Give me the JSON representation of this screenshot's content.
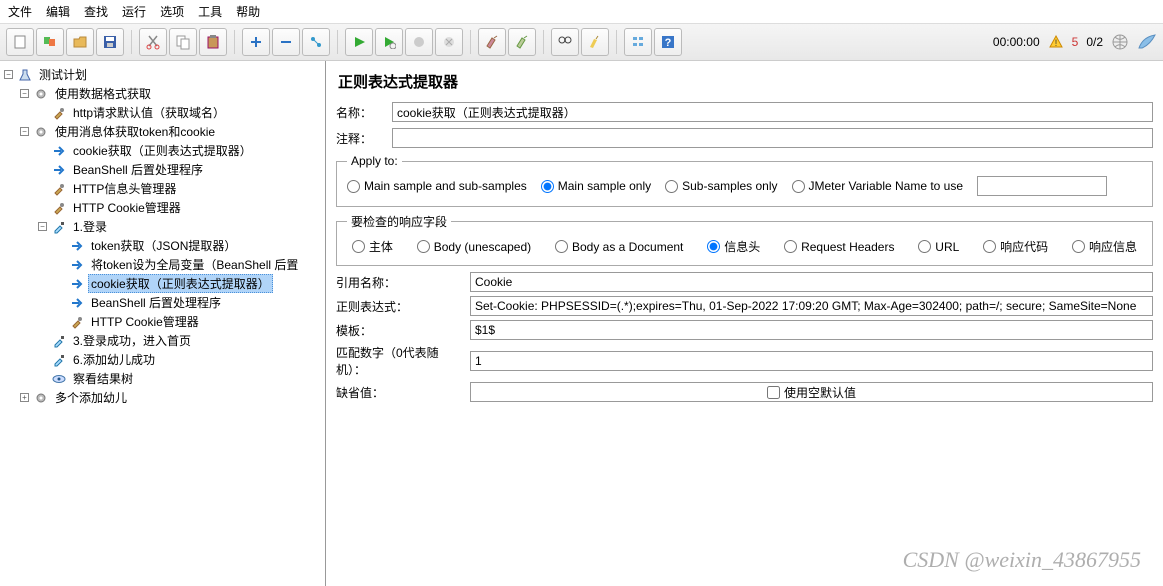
{
  "menu": [
    "文件",
    "编辑",
    "查找",
    "运行",
    "选项",
    "工具",
    "帮助"
  ],
  "status": {
    "time": "00:00:00",
    "warn": 5,
    "threads": "0/2"
  },
  "tree": [
    {
      "d": 0,
      "t": "m",
      "icon": "flask",
      "label": "测试计划"
    },
    {
      "d": 1,
      "t": "m",
      "icon": "gear",
      "label": "使用数据格式获取"
    },
    {
      "d": 2,
      "t": "",
      "icon": "wrench",
      "label": "http请求默认值（获取域名）"
    },
    {
      "d": 1,
      "t": "m",
      "icon": "gear",
      "label": "使用消息体获取token和cookie"
    },
    {
      "d": 2,
      "t": "",
      "icon": "arrow",
      "label": "cookie获取（正则表达式提取器）"
    },
    {
      "d": 2,
      "t": "",
      "icon": "arrow",
      "label": "BeanShell 后置处理程序"
    },
    {
      "d": 2,
      "t": "",
      "icon": "wrench",
      "label": "HTTP信息头管理器"
    },
    {
      "d": 2,
      "t": "",
      "icon": "wrench",
      "label": "HTTP Cookie管理器"
    },
    {
      "d": 2,
      "t": "m",
      "icon": "dropper",
      "label": "1.登录"
    },
    {
      "d": 3,
      "t": "",
      "icon": "arrow",
      "label": "token获取（JSON提取器）"
    },
    {
      "d": 3,
      "t": "",
      "icon": "arrow",
      "label": "将token设为全局变量（BeanShell 后置"
    },
    {
      "d": 3,
      "t": "",
      "icon": "arrow",
      "label": "cookie获取（正则表达式提取器）",
      "sel": true
    },
    {
      "d": 3,
      "t": "",
      "icon": "arrow",
      "label": "BeanShell 后置处理程序"
    },
    {
      "d": 3,
      "t": "",
      "icon": "wrench",
      "label": "HTTP Cookie管理器"
    },
    {
      "d": 2,
      "t": "",
      "icon": "dropper",
      "label": "3.登录成功，进入首页"
    },
    {
      "d": 2,
      "t": "",
      "icon": "dropper",
      "label": "6.添加幼儿成功"
    },
    {
      "d": 2,
      "t": "",
      "icon": "eye",
      "label": "察看结果树"
    },
    {
      "d": 1,
      "t": "p",
      "icon": "gear",
      "label": "多个添加幼儿"
    }
  ],
  "form": {
    "title": "正则表达式提取器",
    "name_lbl": "名称：",
    "name_val": "cookie获取（正则表达式提取器）",
    "comment_lbl": "注释：",
    "comment_val": "",
    "apply_legend": "Apply to:",
    "apply_opts": [
      "Main sample and sub-samples",
      "Main sample only",
      "Sub-samples only",
      "JMeter Variable Name to use"
    ],
    "apply_sel": 1,
    "field_legend": "要检查的响应字段",
    "field_opts": [
      "主体",
      "Body (unescaped)",
      "Body as a Document",
      "信息头",
      "Request Headers",
      "URL",
      "响应代码",
      "响应信息"
    ],
    "field_sel": 3,
    "ref_lbl": "引用名称：",
    "ref_val": "Cookie",
    "regex_lbl": "正则表达式：",
    "regex_val": "Set-Cookie: PHPSESSID=(.*);expires=Thu, 01-Sep-2022 17:09:20 GMT; Max-Age=302400; path=/; secure; SameSite=None",
    "tmpl_lbl": "模板：",
    "tmpl_val": "$1$",
    "match_lbl": "匹配数字（0代表随机）：",
    "match_val": "1",
    "default_lbl": "缺省值：",
    "default_chk": "使用空默认值"
  },
  "watermark": "CSDN @weixin_43867955"
}
